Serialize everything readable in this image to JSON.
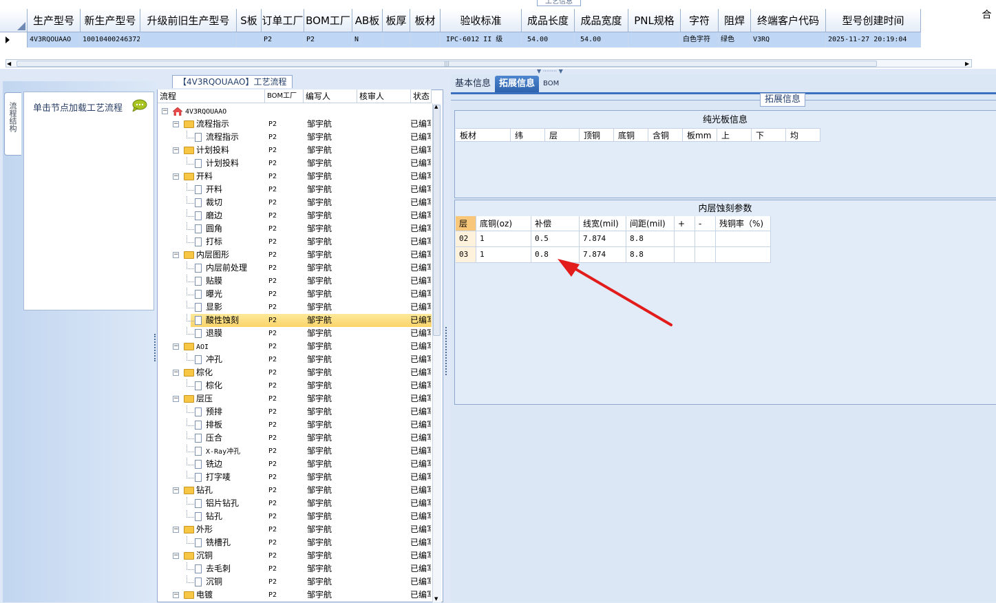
{
  "top_grid": {
    "caption": "工艺信息",
    "columns": [
      "生产型号",
      "新生产型号",
      "升级前旧生产型号",
      "S板",
      "订单工厂",
      "BOM工厂",
      "AB板",
      "板厚",
      "板材",
      "验收标准",
      "成品长度",
      "成品宽度",
      "PNL规格",
      "字符",
      "阻焊",
      "终端客户代码",
      "型号创建时间"
    ],
    "row": [
      "4V3RQOUAAO",
      "10010400246372",
      "",
      "",
      "P2",
      "P2",
      "N",
      "",
      "",
      "IPC-6012 II 级",
      "54.00",
      "54.00",
      "",
      "白色字符",
      "绿色",
      "V3RQ",
      "2025-11-27 20:19:04"
    ],
    "right_label": "合"
  },
  "left_nav": {
    "tab_label": "流程结构",
    "hint": "单击节点加载工艺流程"
  },
  "process_tree": {
    "caption": "【4V3RQOUAAO】工艺流程",
    "columns": [
      "流程",
      "BOM工厂",
      "编写人",
      "核审人",
      "状态"
    ],
    "root": "4V3RQOUAAO",
    "rows": [
      {
        "label": "流程指示",
        "type": "folder",
        "factory": "P2",
        "author": "邹宇航",
        "status": "已编写"
      },
      {
        "label": "流程指示",
        "type": "doc",
        "factory": "P2",
        "author": "邹宇航",
        "status": "已编写"
      },
      {
        "label": "计划投料",
        "type": "folder",
        "factory": "P2",
        "author": "邹宇航",
        "status": "已编写"
      },
      {
        "label": "计划投料",
        "type": "doc",
        "factory": "P2",
        "author": "邹宇航",
        "status": "已编写"
      },
      {
        "label": "开料",
        "type": "folder",
        "factory": "P2",
        "author": "邹宇航",
        "status": "已编写"
      },
      {
        "label": "开料",
        "type": "doc",
        "factory": "P2",
        "author": "邹宇航",
        "status": "已编写"
      },
      {
        "label": "裁切",
        "type": "doc",
        "factory": "P2",
        "author": "邹宇航",
        "status": "已编写"
      },
      {
        "label": "磨边",
        "type": "doc",
        "factory": "P2",
        "author": "邹宇航",
        "status": "已编写"
      },
      {
        "label": "圆角",
        "type": "doc",
        "factory": "P2",
        "author": "邹宇航",
        "status": "已编写"
      },
      {
        "label": "打标",
        "type": "doc",
        "factory": "P2",
        "author": "邹宇航",
        "status": "已编写"
      },
      {
        "label": "内层图形",
        "type": "folder",
        "factory": "P2",
        "author": "邹宇航",
        "status": "已编写"
      },
      {
        "label": "内层前处理",
        "type": "doc",
        "factory": "P2",
        "author": "邹宇航",
        "status": "已编写"
      },
      {
        "label": "贴膜",
        "type": "doc",
        "factory": "P2",
        "author": "邹宇航",
        "status": "已编写"
      },
      {
        "label": "曝光",
        "type": "doc",
        "factory": "P2",
        "author": "邹宇航",
        "status": "已编写"
      },
      {
        "label": "显影",
        "type": "doc",
        "factory": "P2",
        "author": "邹宇航",
        "status": "已编写"
      },
      {
        "label": "酸性蚀刻",
        "type": "doc",
        "factory": "P2",
        "author": "邹宇航",
        "status": "已编写",
        "selected": true
      },
      {
        "label": "退膜",
        "type": "doc",
        "factory": "P2",
        "author": "邹宇航",
        "status": "已编写"
      },
      {
        "label": "AOI",
        "type": "folder",
        "factory": "P2",
        "author": "邹宇航",
        "status": "已编写"
      },
      {
        "label": "冲孔",
        "type": "doc",
        "factory": "P2",
        "author": "邹宇航",
        "status": "已编写"
      },
      {
        "label": "棕化",
        "type": "folder",
        "factory": "P2",
        "author": "邹宇航",
        "status": "已编写"
      },
      {
        "label": "棕化",
        "type": "doc",
        "factory": "P2",
        "author": "邹宇航",
        "status": "已编写"
      },
      {
        "label": "层压",
        "type": "folder",
        "factory": "P2",
        "author": "邹宇航",
        "status": "已编写"
      },
      {
        "label": "预排",
        "type": "doc",
        "factory": "P2",
        "author": "邹宇航",
        "status": "已编写"
      },
      {
        "label": "排板",
        "type": "doc",
        "factory": "P2",
        "author": "邹宇航",
        "status": "已编写"
      },
      {
        "label": "压合",
        "type": "doc",
        "factory": "P2",
        "author": "邹宇航",
        "status": "已编写"
      },
      {
        "label": "X-Ray冲孔",
        "type": "doc",
        "factory": "P2",
        "author": "邹宇航",
        "status": "已编写"
      },
      {
        "label": "铣边",
        "type": "doc",
        "factory": "P2",
        "author": "邹宇航",
        "status": "已编写"
      },
      {
        "label": "打字唛",
        "type": "doc",
        "factory": "P2",
        "author": "邹宇航",
        "status": "已编写"
      },
      {
        "label": "钻孔",
        "type": "folder",
        "factory": "P2",
        "author": "邹宇航",
        "status": "已编写"
      },
      {
        "label": "铝片钻孔",
        "type": "doc",
        "factory": "P2",
        "author": "邹宇航",
        "status": "已编写"
      },
      {
        "label": "钻孔",
        "type": "doc",
        "factory": "P2",
        "author": "邹宇航",
        "status": "已编写"
      },
      {
        "label": "外形",
        "type": "folder",
        "factory": "P2",
        "author": "邹宇航",
        "status": "已编写"
      },
      {
        "label": "铣槽孔",
        "type": "doc",
        "factory": "P2",
        "author": "邹宇航",
        "status": "已编写"
      },
      {
        "label": "沉铜",
        "type": "folder",
        "factory": "P2",
        "author": "邹宇航",
        "status": "已编写"
      },
      {
        "label": "去毛刺",
        "type": "doc",
        "factory": "P2",
        "author": "邹宇航",
        "status": "已编写"
      },
      {
        "label": "沉铜",
        "type": "doc",
        "factory": "P2",
        "author": "邹宇航",
        "status": "已编写"
      },
      {
        "label": "电镀",
        "type": "folder",
        "factory": "P2",
        "author": "邹宇航",
        "status": "已编写"
      }
    ]
  },
  "tabs": [
    "基本信息",
    "拓展信息",
    "BOM"
  ],
  "active_tab": 1,
  "ext_info": {
    "caption": "拓展信息",
    "pure_title": "纯光板信息",
    "pure_columns": [
      "板材",
      "纬",
      "层",
      "顶铜",
      "底铜",
      "含铜",
      "板mm",
      "上",
      "下",
      "均"
    ],
    "inner_title": "内层蚀刻参数",
    "inner_columns": [
      "层",
      "底铜(oz)",
      "补偿",
      "线宽(mil)",
      "间距(mil)",
      "+",
      "-",
      "残铜率（%)"
    ],
    "inner_rows": [
      [
        "02",
        "1",
        "0.5",
        "7.874",
        "8.8",
        "",
        "",
        ""
      ],
      [
        "03",
        "1",
        "0.8",
        "7.874",
        "8.8",
        "",
        "",
        ""
      ]
    ]
  },
  "colors": {
    "accent": "#2e63ae",
    "selection": "#fbd46a",
    "arrow": "#e21b1b"
  }
}
